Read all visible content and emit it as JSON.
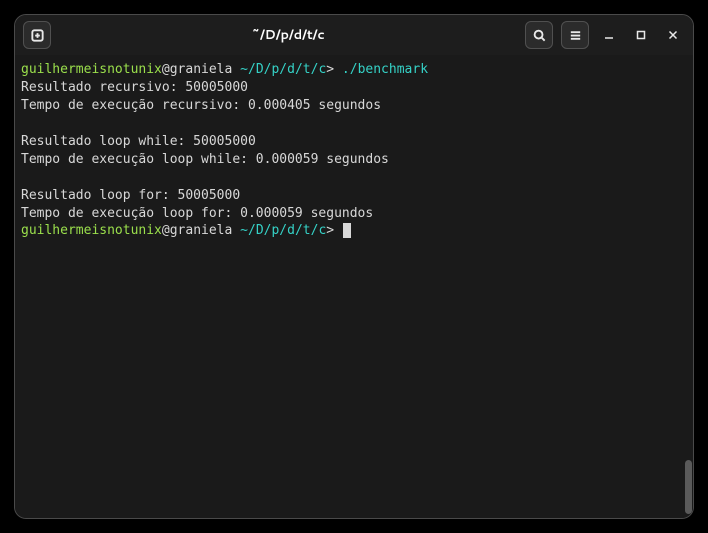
{
  "titlebar": {
    "title": "~/D/p/d/t/c"
  },
  "prompt": {
    "user": "guilhermeisnotunix",
    "host": "@graniela ",
    "path": "~/D/p/d/t/c",
    "sep": "> ",
    "command": "./benchmark"
  },
  "output": {
    "l1": "Resultado recursivo: 50005000",
    "l2": "Tempo de execução recursivo: 0.000405 segundos",
    "l3": "Resultado loop while: 50005000",
    "l4": "Tempo de execução loop while: 0.000059 segundos",
    "l5": "Resultado loop for: 50005000",
    "l6": "Tempo de execução loop for: 0.000059 segundos"
  }
}
